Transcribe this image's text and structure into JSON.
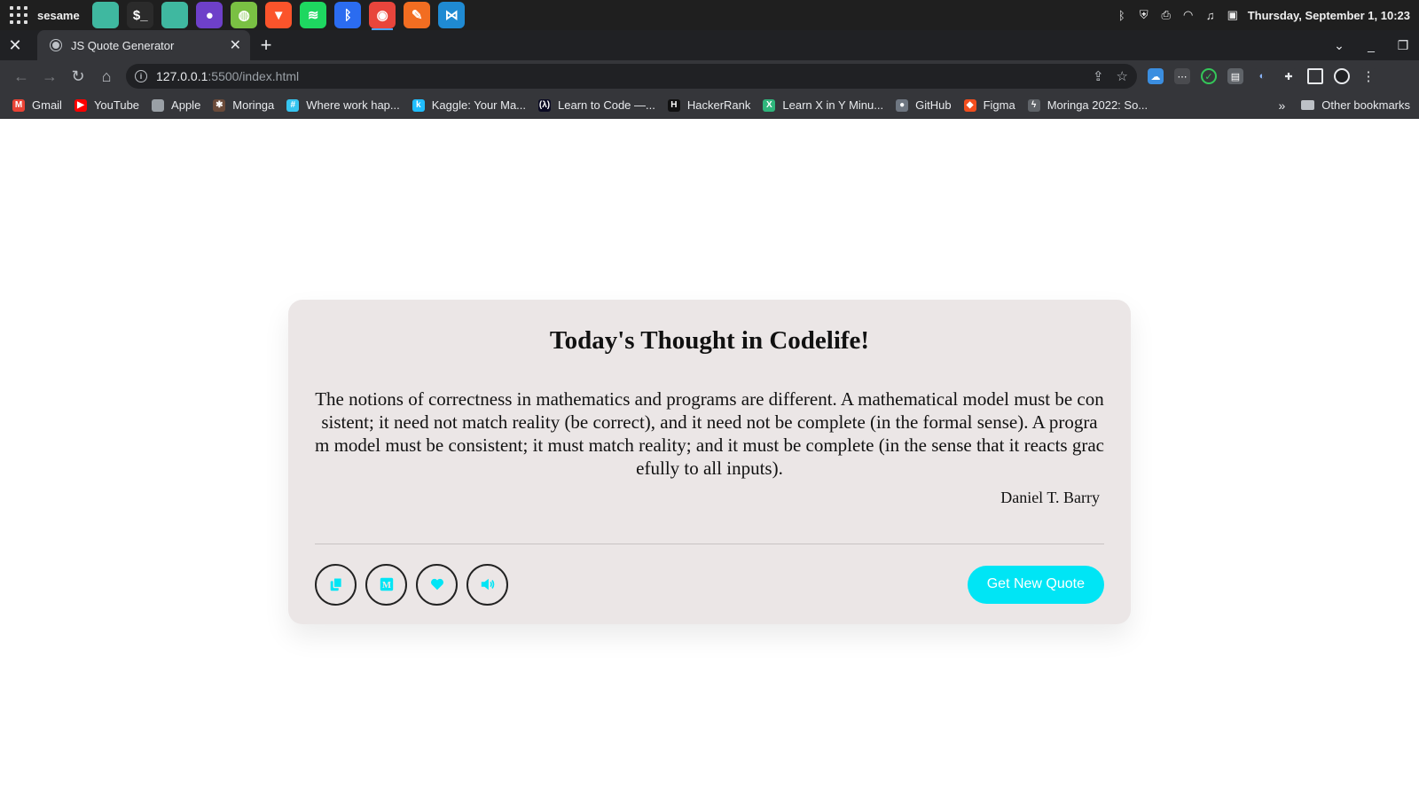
{
  "os": {
    "user_label": "sesame",
    "dock_apps": [
      {
        "name": "files-icon",
        "bg": "#3fb8a0",
        "glyph": ""
      },
      {
        "name": "terminal-icon",
        "bg": "#2b2b2b",
        "glyph": "$_"
      },
      {
        "name": "folder-icon",
        "bg": "#3fb8a0",
        "glyph": ""
      },
      {
        "name": "github-desktop-icon",
        "bg": "#6e40c9",
        "glyph": "●"
      },
      {
        "name": "network-icon",
        "bg": "#7ac043",
        "glyph": "◍"
      },
      {
        "name": "brave-icon",
        "bg": "#fb542b",
        "glyph": "▼"
      },
      {
        "name": "spotify-icon",
        "bg": "#1ed760",
        "glyph": "≋"
      },
      {
        "name": "bluetooth-icon",
        "bg": "#2b6cf0",
        "glyph": "ᛒ"
      },
      {
        "name": "chrome-icon",
        "bg": "#e8453c",
        "glyph": "◉"
      },
      {
        "name": "sketch-icon",
        "bg": "#f26d21",
        "glyph": "✎"
      },
      {
        "name": "vscode-icon",
        "bg": "#1f8ad2",
        "glyph": "⋈"
      }
    ],
    "clock": "Thursday, September  1, 10:23"
  },
  "browser": {
    "tab_title": "JS Quote Generator",
    "url_host": "127.0.0.1",
    "url_path": ":5500/index.html",
    "bookmarks": [
      {
        "label": "Gmail",
        "icon": "gmail-icon",
        "color": "#ea4335",
        "glyph": "M"
      },
      {
        "label": "YouTube",
        "icon": "youtube-icon",
        "color": "#ff0000",
        "glyph": "▶"
      },
      {
        "label": "Apple",
        "icon": "apple-icon",
        "color": "#9aa0a6",
        "glyph": ""
      },
      {
        "label": "Moringa",
        "icon": "moringa-icon",
        "color": "#6b4b3a",
        "glyph": "✱"
      },
      {
        "label": "Where work hap...",
        "icon": "slack-icon",
        "color": "#36c5f0",
        "glyph": "#"
      },
      {
        "label": "Kaggle: Your Ma...",
        "icon": "kaggle-icon",
        "color": "#20beff",
        "glyph": "k"
      },
      {
        "label": "Learn to Code —...",
        "icon": "freecodecamp-icon",
        "color": "#0a0a23",
        "glyph": "(λ)"
      },
      {
        "label": "HackerRank",
        "icon": "hackerrank-icon",
        "color": "#111111",
        "glyph": "H"
      },
      {
        "label": "Learn X in Y Minu...",
        "icon": "learnxiny-icon",
        "color": "#2fb67c",
        "glyph": "X"
      },
      {
        "label": "GitHub",
        "icon": "github-icon",
        "color": "#6e7681",
        "glyph": "●"
      },
      {
        "label": "Figma",
        "icon": "figma-icon",
        "color": "#f24e1e",
        "glyph": "◆"
      },
      {
        "label": "Moringa 2022: So...",
        "icon": "moringa-2022-icon",
        "color": "#5f6368",
        "glyph": "ϟ"
      }
    ],
    "bookmarks_more": "»",
    "other_bookmarks": "Other bookmarks"
  },
  "quote_card": {
    "heading": "Today's Thought in Codelife!",
    "quote": "The notions of correctness in mathematics and programs are different. A mathematical model must be consistent; it need not match reality (be correct), and it need not be complete (in the formal sense). A program model must be consistent; it must match reality; and it must be complete (in the sense that it reacts gracefully to all inputs).",
    "author": "Daniel T. Barry",
    "new_quote_label": "Get New Quote",
    "accent_color": "#00e5f5",
    "action_buttons": [
      "copy-button",
      "medium-button",
      "like-button",
      "speak-button"
    ]
  }
}
